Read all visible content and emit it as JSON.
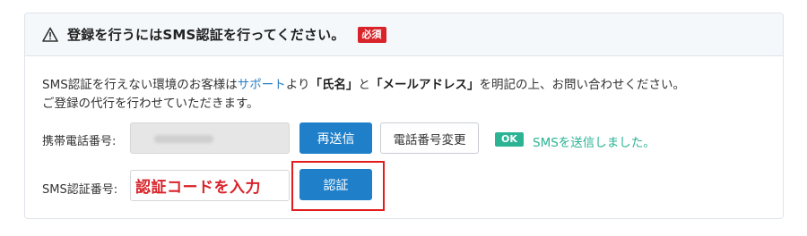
{
  "header": {
    "title": "登録を行うにはSMS認証を行ってください。",
    "required_badge": "必須",
    "icon": "warning-triangle-icon"
  },
  "notice": {
    "line1_part1": "SMS認証を行えない環境のお客様は",
    "support_link": "サポート",
    "line1_part2": "より",
    "name_field": "「氏名」",
    "line1_part3": "と",
    "email_field": "「メールアドレス」",
    "line1_part4": "を明記の上、お問い合わせください。",
    "line2": "ご登録の代行を行わせていただきます。"
  },
  "phone_row": {
    "label": "携帯電話番号:",
    "resend_button": "再送信",
    "change_button": "電話番号変更",
    "ok_badge": "OK",
    "status_message": "SMSを送信しました。"
  },
  "code_row": {
    "label": "SMS認証番号:",
    "input_value": "認証コードを入力",
    "verify_button": "認証"
  },
  "colors": {
    "primary": "#1f7fc9",
    "required": "#d8232a",
    "success": "#2bb394",
    "link": "#2a7fc4",
    "highlight": "#e21d1d"
  }
}
